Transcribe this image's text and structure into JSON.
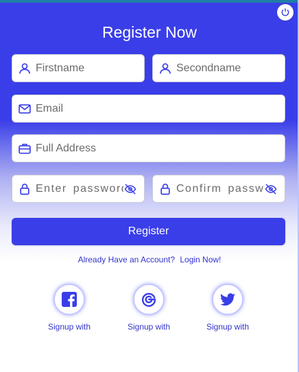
{
  "form": {
    "title": "Register Now",
    "firstname": {
      "placeholder": "Firstname",
      "icon": "user-icon"
    },
    "secondname": {
      "placeholder": "Secondname",
      "icon": "user-icon"
    },
    "email": {
      "placeholder": "Email",
      "icon": "mail-icon"
    },
    "address": {
      "placeholder": "Full Address",
      "icon": "briefcase-icon"
    },
    "password": {
      "placeholder": "Enter password",
      "icon": "lock-icon",
      "toggle_icon": "eye-off-icon"
    },
    "confirm": {
      "placeholder": "Confirm password",
      "icon": "lock-icon",
      "toggle_icon": "eye-off-icon"
    },
    "register_label": "Register",
    "login_prompt": "Already Have an Account?",
    "login_link": "Login Now!"
  },
  "social": [
    {
      "label": "Signup with",
      "icon": "facebook-icon"
    },
    {
      "label": "Signup with",
      "icon": "google-icon"
    },
    {
      "label": "Signup with",
      "icon": "twitter-icon"
    }
  ],
  "colors": {
    "primary": "#3a3ee8",
    "text_link": "#3434c8",
    "border": "#c9c9d6"
  }
}
